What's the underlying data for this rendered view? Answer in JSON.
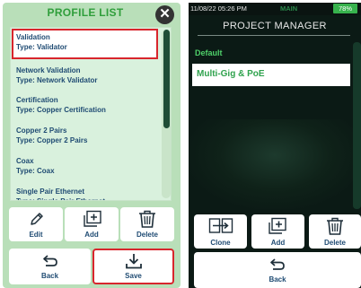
{
  "left_panel": {
    "title": "PROFILE LIST",
    "close_icon": "close-icon",
    "profiles": [
      {
        "name": "Validation",
        "type": "Type: Validator",
        "selected": true
      },
      {
        "name": "Network Validation",
        "type": "Type: Network Validator"
      },
      {
        "name": "Certification",
        "type": "Type: Copper Certification"
      },
      {
        "name": "Copper 2 Pairs",
        "type": "Type: Copper 2 Pairs"
      },
      {
        "name": "Coax",
        "type": "Type: Coax"
      },
      {
        "name": "Single Pair Ethernet",
        "type": "Type: Single Pair Ethernet"
      }
    ],
    "buttons": {
      "edit": "Edit",
      "add": "Add",
      "delete": "Delete",
      "back": "Back",
      "save": "Save"
    },
    "colors": {
      "title": "#2f9e3b",
      "highlight": "#d8262d",
      "background": "#b9dfb9"
    }
  },
  "right_panel": {
    "status": {
      "time": "11/08/22 05:26 PM",
      "mode": "MAIN",
      "battery": "78%"
    },
    "title": "PROJECT MANAGER",
    "section": "Default",
    "project": "Multi-Gig & PoE",
    "buttons": {
      "clone": "Clone",
      "add": "Add",
      "delete": "Delete",
      "back": "Back"
    },
    "colors": {
      "accent": "#4fd06a",
      "battery": "#37b24d",
      "background": "#0b1a15"
    }
  }
}
